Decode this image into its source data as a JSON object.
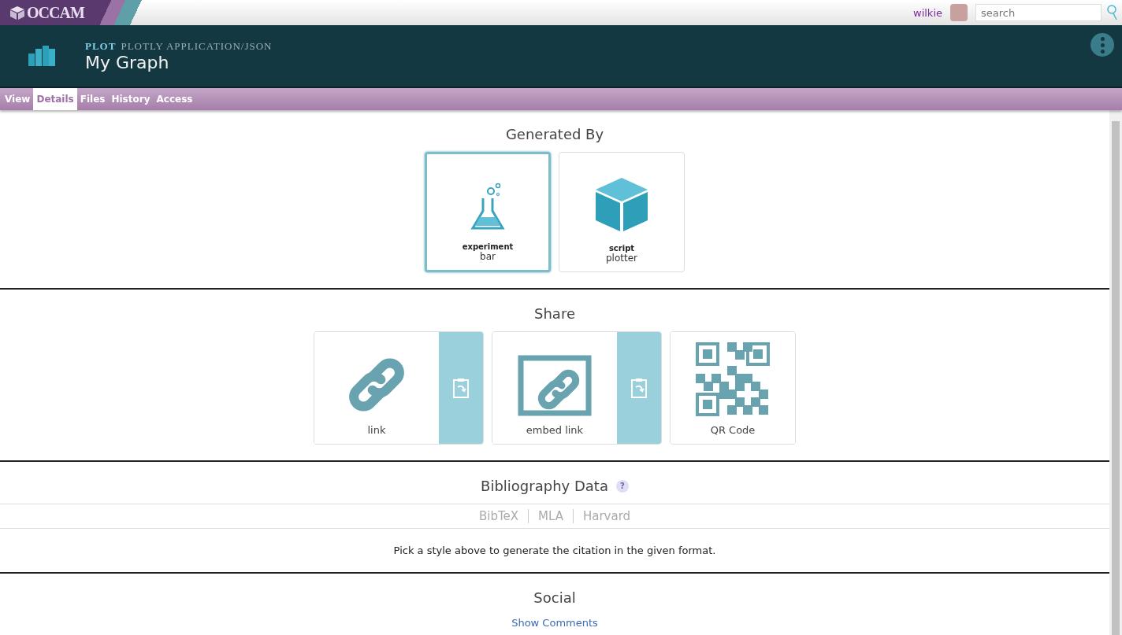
{
  "topbar": {
    "logo": "OCCAM",
    "username": "wilkie",
    "search": {
      "placeholder": "search"
    }
  },
  "header": {
    "type": "PLOT",
    "subtype": "PLOTLY APPLICATION/JSON",
    "title": "My Graph"
  },
  "tabs": [
    {
      "label": "View",
      "selected": false
    },
    {
      "label": "Details",
      "selected": true
    },
    {
      "label": "Files",
      "selected": false
    },
    {
      "label": "History",
      "selected": false
    },
    {
      "label": "Access",
      "selected": false
    }
  ],
  "generated_by": {
    "heading": "Generated By",
    "items": [
      {
        "kind": "experiment",
        "type": "experiment",
        "name": "bar",
        "selected": true
      },
      {
        "kind": "script",
        "type": "script",
        "name": "plotter",
        "selected": false
      }
    ]
  },
  "share": {
    "heading": "Share",
    "items": [
      {
        "kind": "link",
        "label": "link"
      },
      {
        "kind": "embed",
        "label": "embed link"
      },
      {
        "kind": "qr",
        "label": "QR Code"
      }
    ]
  },
  "bibliography": {
    "heading": "Bibliography Data",
    "help": "?",
    "styles": [
      "BibTeX",
      "MLA",
      "Harvard"
    ],
    "message": "Pick a style above to generate the citation in the given format."
  },
  "social": {
    "heading": "Social",
    "link": "Show Comments"
  }
}
